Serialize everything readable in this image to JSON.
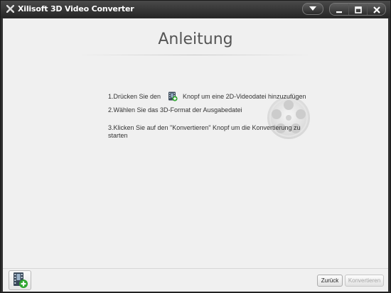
{
  "titlebar": {
    "title": "Xilisoft 3D Video Converter",
    "icons": [
      "app-logo-icon",
      "dropdown-menu-icon",
      "minimize-icon",
      "maximize-icon",
      "close-icon"
    ]
  },
  "main": {
    "heading": "Anleitung",
    "step1_before": "1.Drücken Sie den",
    "step1_icon": "add-video-icon",
    "step1_after": "Knopf um eine 2D-Videodatei hinzuzufügen",
    "step2": "2.Wählen Sie das 3D-Format der Ausgabedatei",
    "step3": "3.Klicken Sie auf den \"Konvertieren\" Knopf um die Konvertierung zu starten",
    "watermark_icon": "film-reel-icon"
  },
  "bottombar": {
    "add_button_icon": "add-video-icon",
    "back_label": "Zurück",
    "convert_label": "Konvertieren",
    "convert_enabled": false
  },
  "colors": {
    "titlebar": "#2f2f2f",
    "content_bg": "#f0f0f0",
    "heading": "#555555",
    "accent_green": "#2ea52e"
  }
}
